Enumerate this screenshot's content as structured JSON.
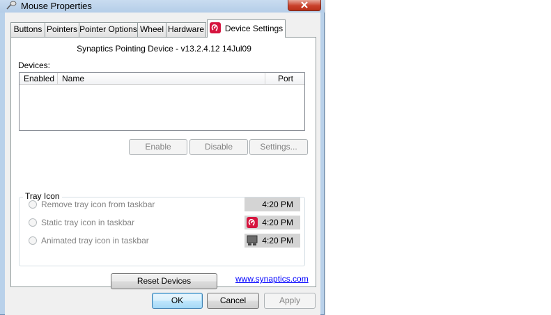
{
  "window": {
    "title": "Mouse Properties"
  },
  "tabs": [
    {
      "label": "Buttons"
    },
    {
      "label": "Pointers"
    },
    {
      "label": "Pointer Options"
    },
    {
      "label": "Wheel"
    },
    {
      "label": "Hardware"
    },
    {
      "label": "Device Settings",
      "active": true
    }
  ],
  "device_settings": {
    "device_title": "Synaptics Pointing Device - v13.2.4.12 14Jul09",
    "devices_label": "Devices:",
    "columns": [
      "Enabled",
      "Name",
      "Port"
    ],
    "rows": [],
    "buttons": {
      "enable": "Enable",
      "disable": "Disable",
      "settings": "Settings..."
    },
    "tray_icon": {
      "group_label": "Tray Icon",
      "options": [
        {
          "label": "Remove tray icon from taskbar",
          "time": "4:20 PM",
          "icon": "none"
        },
        {
          "label": "Static tray icon in taskbar",
          "time": "4:20 PM",
          "icon": "synaptics-logo-icon"
        },
        {
          "label": "Animated tray icon in taskbar",
          "time": "4:20 PM",
          "icon": "touchpad-icon"
        }
      ]
    },
    "reset_label": "Reset Devices",
    "link_text": "www.synaptics.com"
  },
  "dialog_buttons": {
    "ok": "OK",
    "cancel": "Cancel",
    "apply": "Apply"
  },
  "colors": {
    "synaptics_red": "#d6153f",
    "link": "#0000ff",
    "close_red": "#c9412b"
  }
}
